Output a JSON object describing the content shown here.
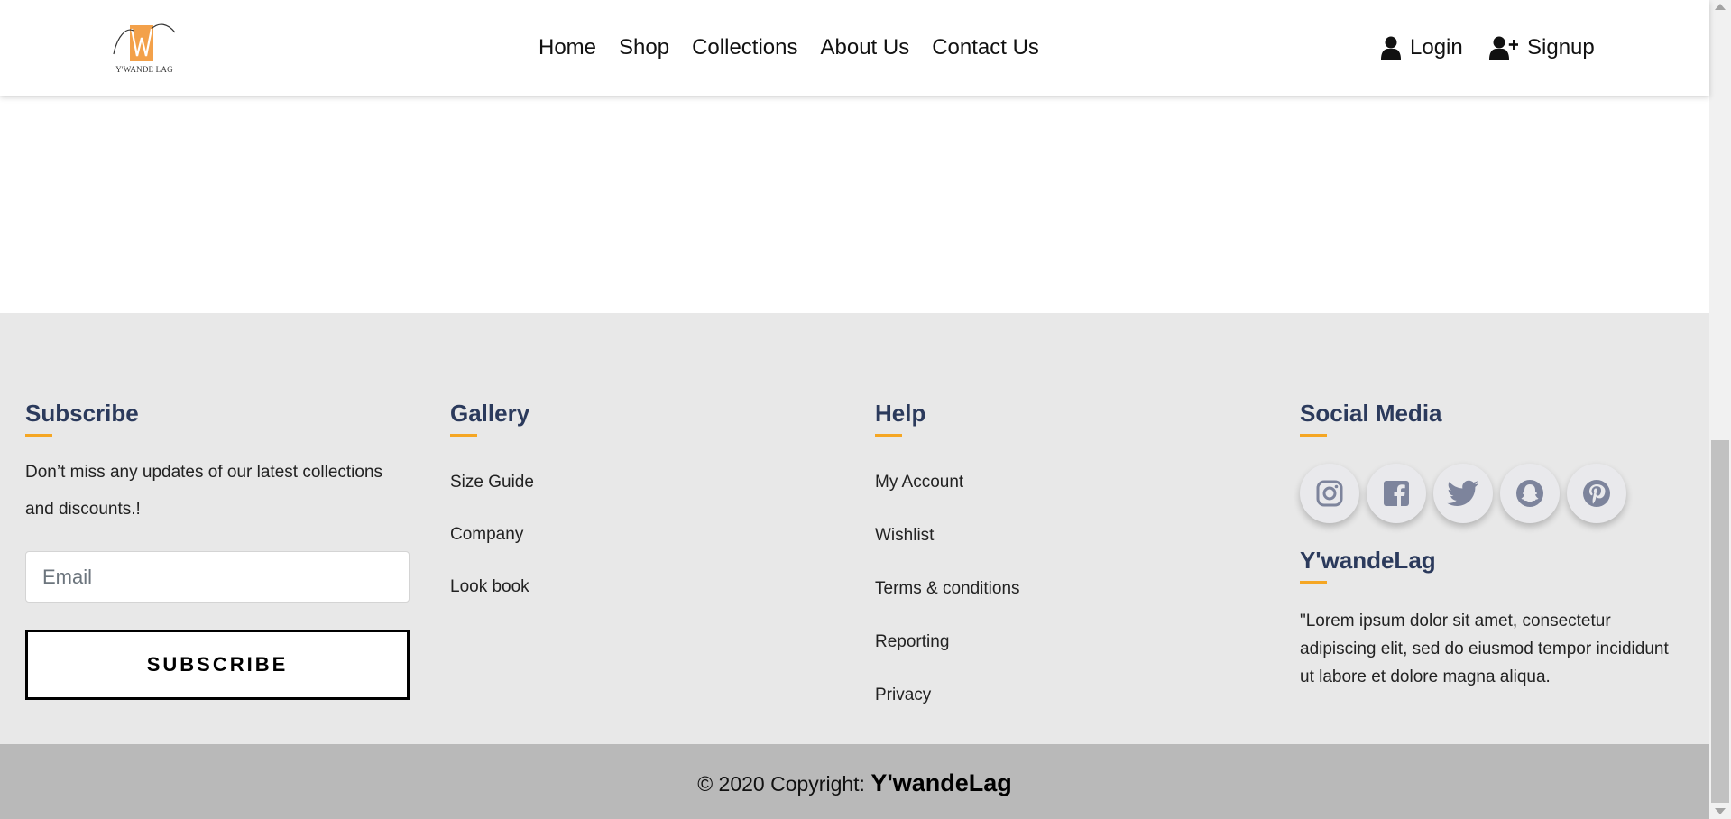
{
  "brand": {
    "logo_text": "Y'WANDE LAG",
    "accent_color": "#f5a623",
    "heading_color": "#2b3a5c"
  },
  "nav": {
    "items": [
      "Home",
      "Shop",
      "Collections",
      "About Us",
      "Contact Us"
    ]
  },
  "auth": {
    "login_label": "Login",
    "signup_label": "Signup",
    "login_icon": "user-icon",
    "signup_icon": "user-plus-icon"
  },
  "footer": {
    "subscribe": {
      "title": "Subscribe",
      "text": "Don’t miss any updates of our latest collections and discounts.!",
      "email_placeholder": "Email",
      "button_label": "SUBSCRIBE"
    },
    "gallery": {
      "title": "Gallery",
      "links": [
        "Size Guide",
        "Company",
        "Look book"
      ]
    },
    "help": {
      "title": "Help",
      "links": [
        "My Account",
        "Wishlist",
        "Terms & conditions",
        "Reporting",
        "Privacy"
      ]
    },
    "social": {
      "title": "Social Media",
      "icons": [
        "instagram-icon",
        "facebook-icon",
        "twitter-icon",
        "snapchat-icon",
        "pinterest-icon"
      ],
      "brand_title": "Y'wandeLag",
      "description": "\"Lorem ipsum dolor sit amet, consectetur adipiscing elit, sed do eiusmod tempor incididunt ut labore et dolore magna aliqua."
    },
    "copyright": {
      "prefix": "© 2020 Copyright: ",
      "brand": "Y'wandeLag"
    }
  }
}
